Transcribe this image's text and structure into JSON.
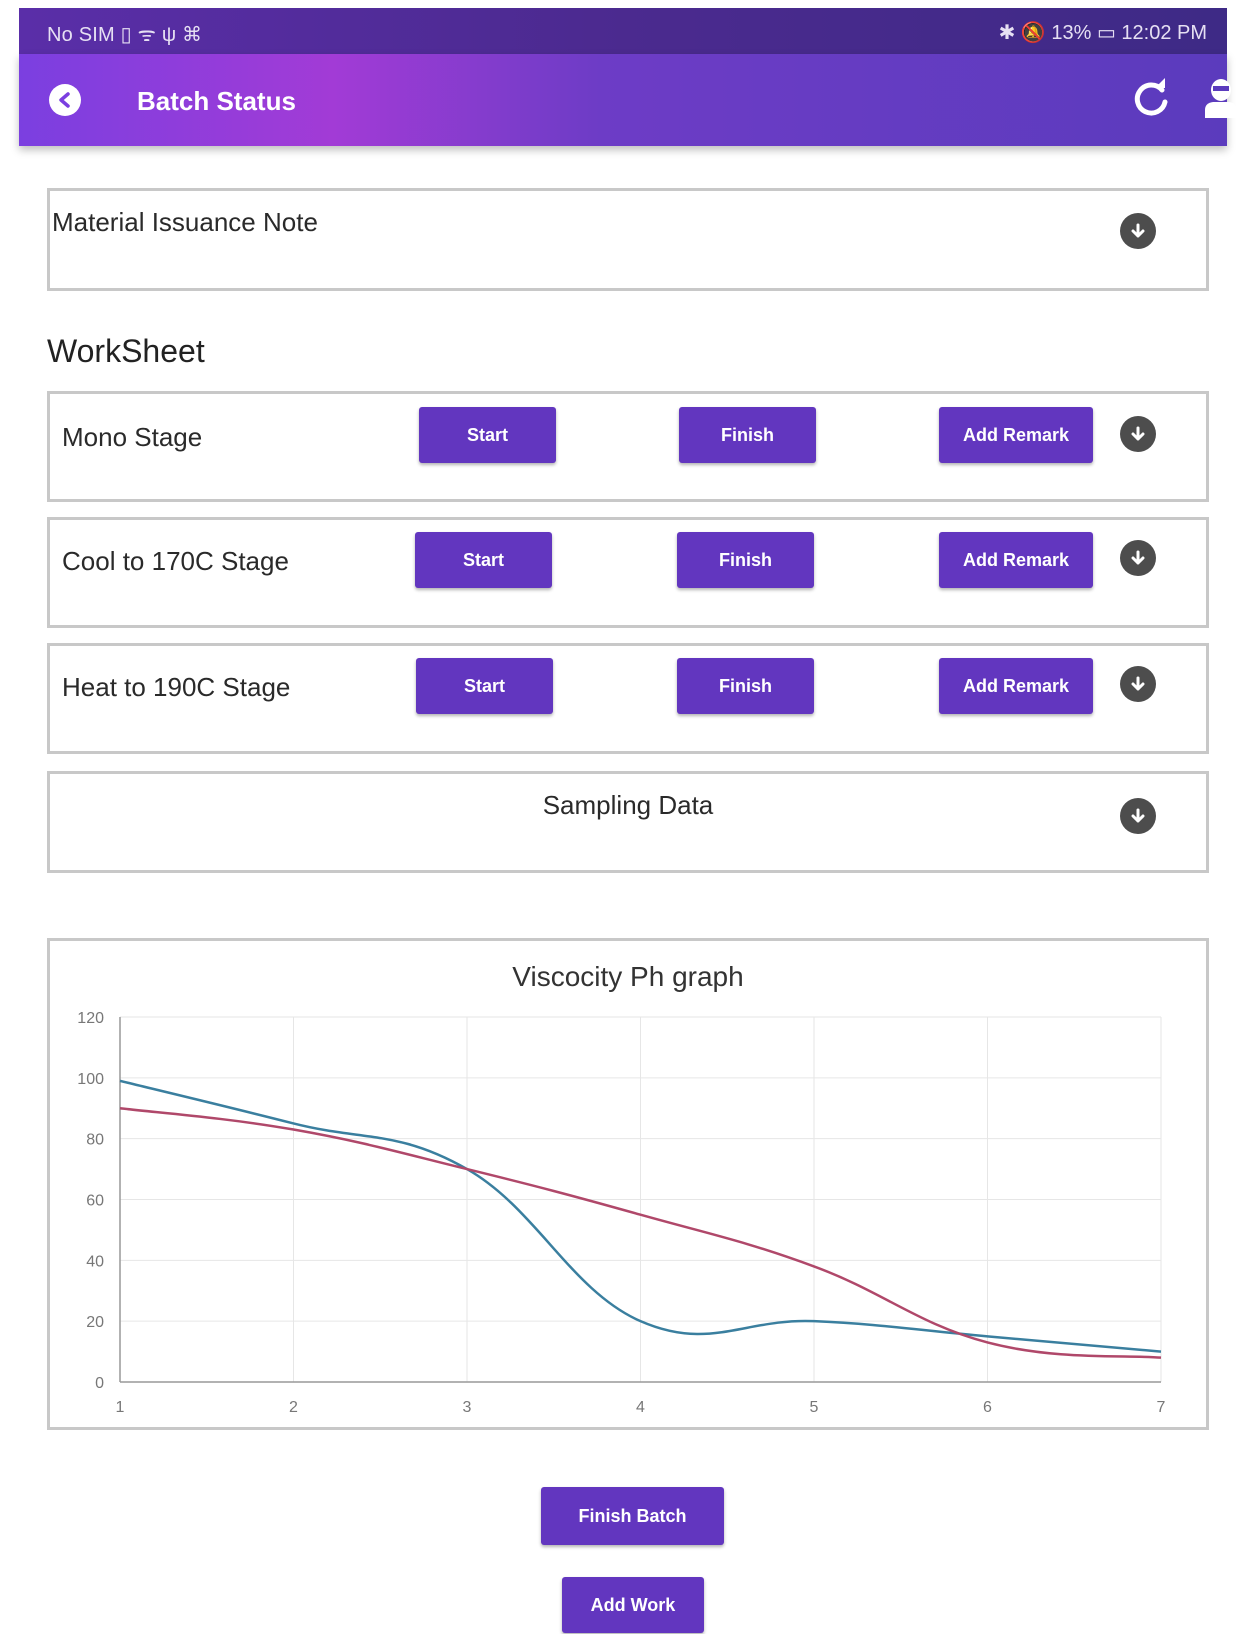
{
  "status_bar": {
    "left": "No SIM ▯ ᯤ ψ ⌘",
    "right": "✱ 🔕 13% ▭ 12:02 PM"
  },
  "app_bar": {
    "title": "Batch Status",
    "back_icon": "back-arrow-circle-icon",
    "refresh_icon": "refresh-icon",
    "profile_icon": "user-profile-icon"
  },
  "material_note": {
    "label": "Material Issuance Note"
  },
  "worksheet": {
    "heading": "WorkSheet",
    "stages": [
      {
        "name": "Mono Stage",
        "start": "Start",
        "finish": "Finish",
        "remark": "Add Remark"
      },
      {
        "name": "Cool to 170C Stage",
        "start": "Start",
        "finish": "Finish",
        "remark": "Add Remark"
      },
      {
        "name": "Heat to 190C Stage",
        "start": "Start",
        "finish": "Finish",
        "remark": "Add Remark"
      }
    ],
    "sampling": {
      "label": "Sampling Data"
    }
  },
  "chart_data": {
    "type": "line",
    "title": "Viscocity Ph graph",
    "x": [
      1,
      2,
      3,
      4,
      5,
      6,
      7
    ],
    "ylim": [
      0,
      120
    ],
    "y_ticks": [
      0,
      20,
      40,
      60,
      80,
      100,
      120
    ],
    "x_ticks": [
      1,
      2,
      3,
      4,
      5,
      6,
      7
    ],
    "grid": true,
    "series": [
      {
        "color": "#3a7f9f",
        "values": [
          99,
          85,
          70,
          20,
          20,
          15,
          10
        ]
      },
      {
        "color": "#b0486a",
        "values": [
          90,
          83,
          70,
          55,
          38,
          13,
          8
        ]
      }
    ]
  },
  "actions": {
    "finish_batch": "Finish Batch",
    "add_work": "Add Work"
  },
  "colors": {
    "primary": "#6236bf",
    "appbar_start": "#7b3fe0",
    "appbar_end": "#5b3bbd"
  }
}
